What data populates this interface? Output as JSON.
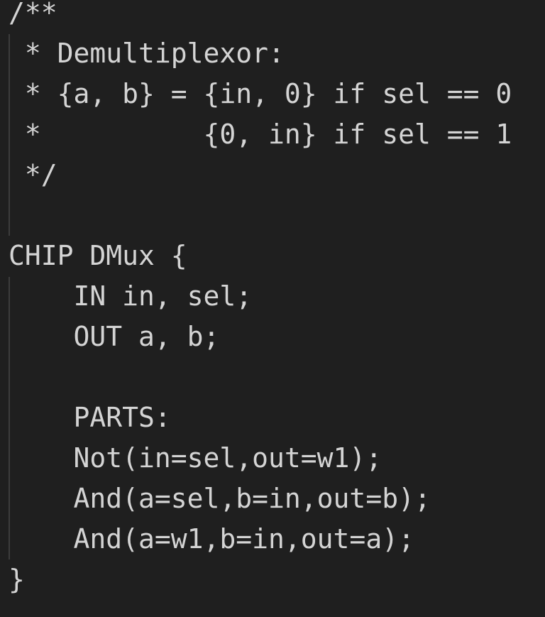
{
  "editor": {
    "language": "HDL",
    "lines": [
      "/**",
      " * Demultiplexor:",
      " * {a, b} = {in, 0} if sel == 0",
      " *          {0, in} if sel == 1",
      " */",
      "",
      "CHIP DMux {",
      "    IN in, sel;",
      "    OUT a, b;",
      "",
      "    PARTS:",
      "    Not(in=sel,out=w1);",
      "    And(a=sel,b=in,out=b);",
      "    And(a=w1,b=in,out=a);",
      "}"
    ]
  },
  "colors": {
    "background": "#1f1f1f",
    "text": "#d4d4d4",
    "indent_guide": "#3c3c3c"
  }
}
